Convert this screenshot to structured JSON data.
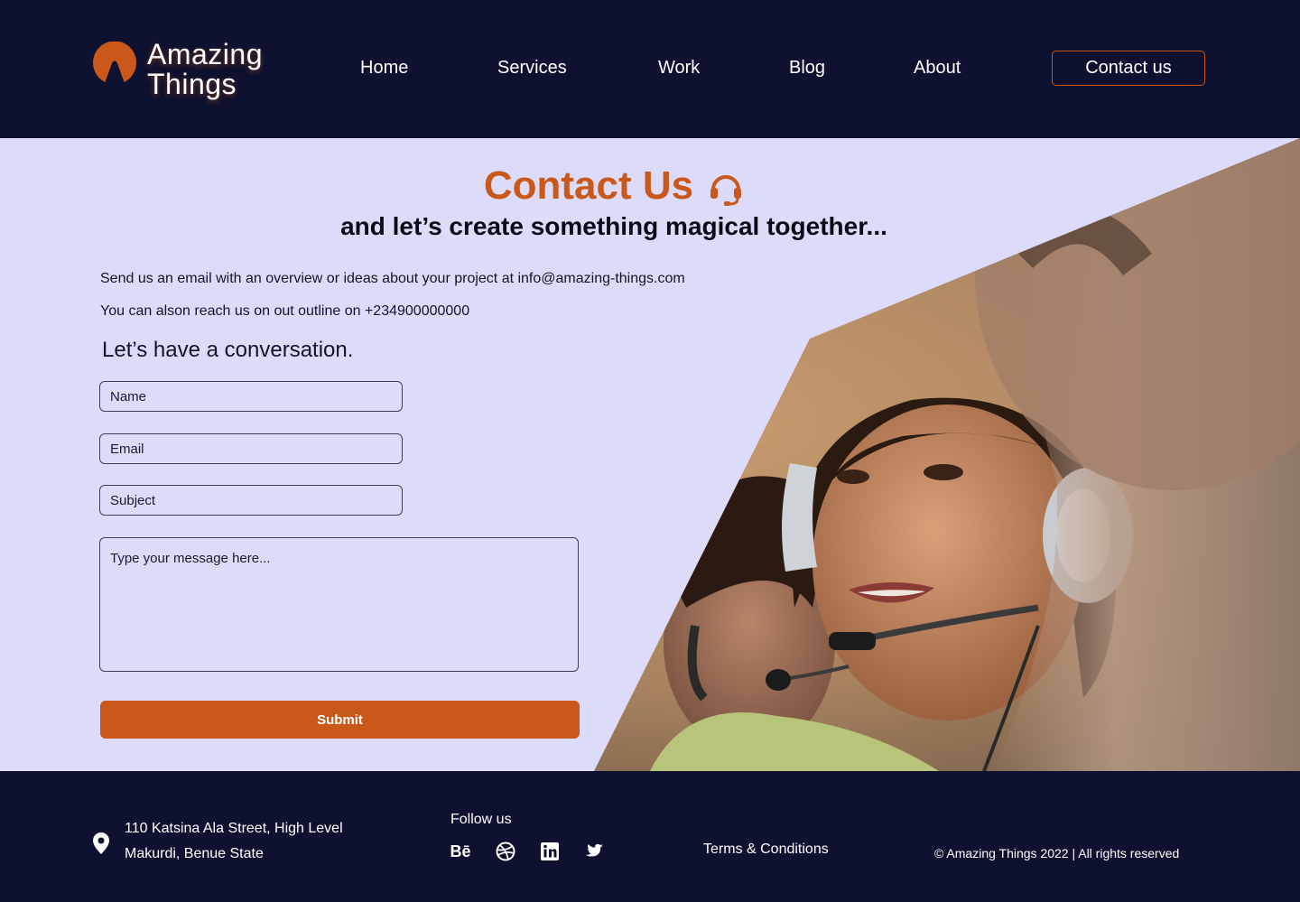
{
  "colors": {
    "navy": "#0f1130",
    "accent": "#c9581a",
    "panel": "#dcdcfa"
  },
  "header": {
    "logo_line1": "Amazing",
    "logo_line2": "Things",
    "nav": [
      "Home",
      "Services",
      "Work",
      "Blog",
      "About"
    ],
    "cta": "Contact us"
  },
  "main": {
    "title": "Contact Us",
    "title_icon": "headset-icon",
    "subtitle": "and let’s create something magical together...",
    "info_email_line": "Send us an email with an overview or ideas about your project at info@amazing-things.com",
    "info_phone_line": "You can alson reach us on out outline on +234900000000",
    "conversation_heading": "Let’s have a conversation.",
    "form": {
      "name_placeholder": "Name",
      "email_placeholder": "Email",
      "subject_placeholder": "Subject",
      "message_placeholder": "Type your message here...",
      "submit_label": "Submit"
    }
  },
  "footer": {
    "address_icon": "location-pin-icon",
    "address_line1": "110 Katsina Ala Street, High Level",
    "address_line2": "Makurdi, Benue State",
    "follow_label": "Follow us",
    "social": [
      "behance-icon",
      "dribbble-icon",
      "linkedin-icon",
      "twitter-icon"
    ],
    "behance_text": "Bē",
    "terms": "Terms & Conditions",
    "copyright": "© Amazing Things 2022 | All rights reserved"
  }
}
